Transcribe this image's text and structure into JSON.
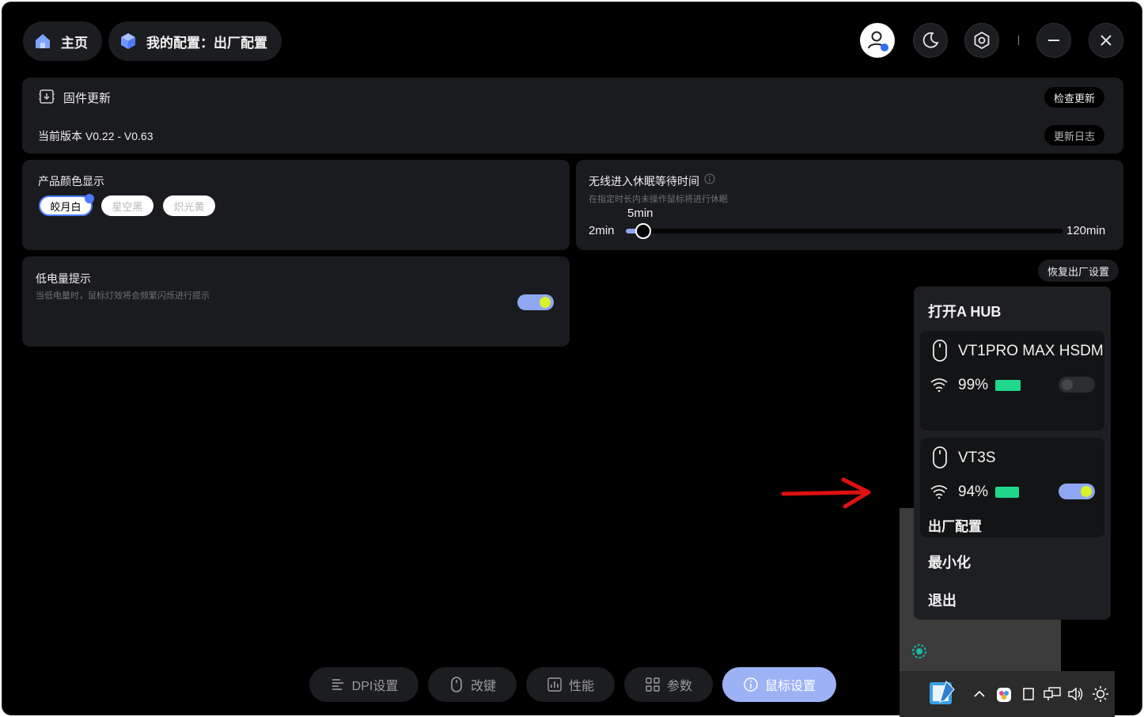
{
  "header": {
    "home_label": "主页",
    "config_label": "我的配置：出厂配置"
  },
  "firmware": {
    "title": "固件更新",
    "version_text": "当前版本 V0.22 - V0.63",
    "check_update": "检查更新",
    "changelog": "更新日志"
  },
  "color_display": {
    "title": "产品颜色显示",
    "options": [
      "皎月白",
      "星空黑",
      "炽光黄"
    ],
    "selected": "皎月白"
  },
  "sleep": {
    "title": "无线进入休眠等待时间",
    "subtitle": "在指定时长内未操作鼠标将进行休眠",
    "min_label": "2min",
    "max_label": "120min",
    "value_label": "5min",
    "min": 2,
    "max": 120,
    "value": 5
  },
  "low_battery": {
    "title": "低电量提示",
    "subtitle": "当低电量时，鼠标灯效将会频繁闪烁进行提示",
    "enabled": true
  },
  "reset_button": "恢复出厂设置",
  "tabs": [
    {
      "label": "DPI设置",
      "icon": "list-icon"
    },
    {
      "label": "改键",
      "icon": "mouse-icon"
    },
    {
      "label": "性能",
      "icon": "chart-icon"
    },
    {
      "label": "参数",
      "icon": "grid-icon"
    },
    {
      "label": "鼠标设置",
      "icon": "info-icon",
      "active": true
    }
  ],
  "tray_menu": {
    "open_hub": "打开A HUB",
    "devices": [
      {
        "name": "VT1PRO MAX HSDM",
        "battery_pct": "99%",
        "battery_level": 0.99,
        "enabled": false
      },
      {
        "name": "VT3S",
        "battery_pct": "94%",
        "battery_level": 0.94,
        "enabled": true,
        "config": "出厂配置"
      }
    ],
    "minimize": "最小化",
    "exit": "退出"
  },
  "colors": {
    "accent": "#9db2f5",
    "toggle_knob": "#d9f22a",
    "battery": "#1fd88c",
    "annotation_arrow": "#e01010"
  }
}
